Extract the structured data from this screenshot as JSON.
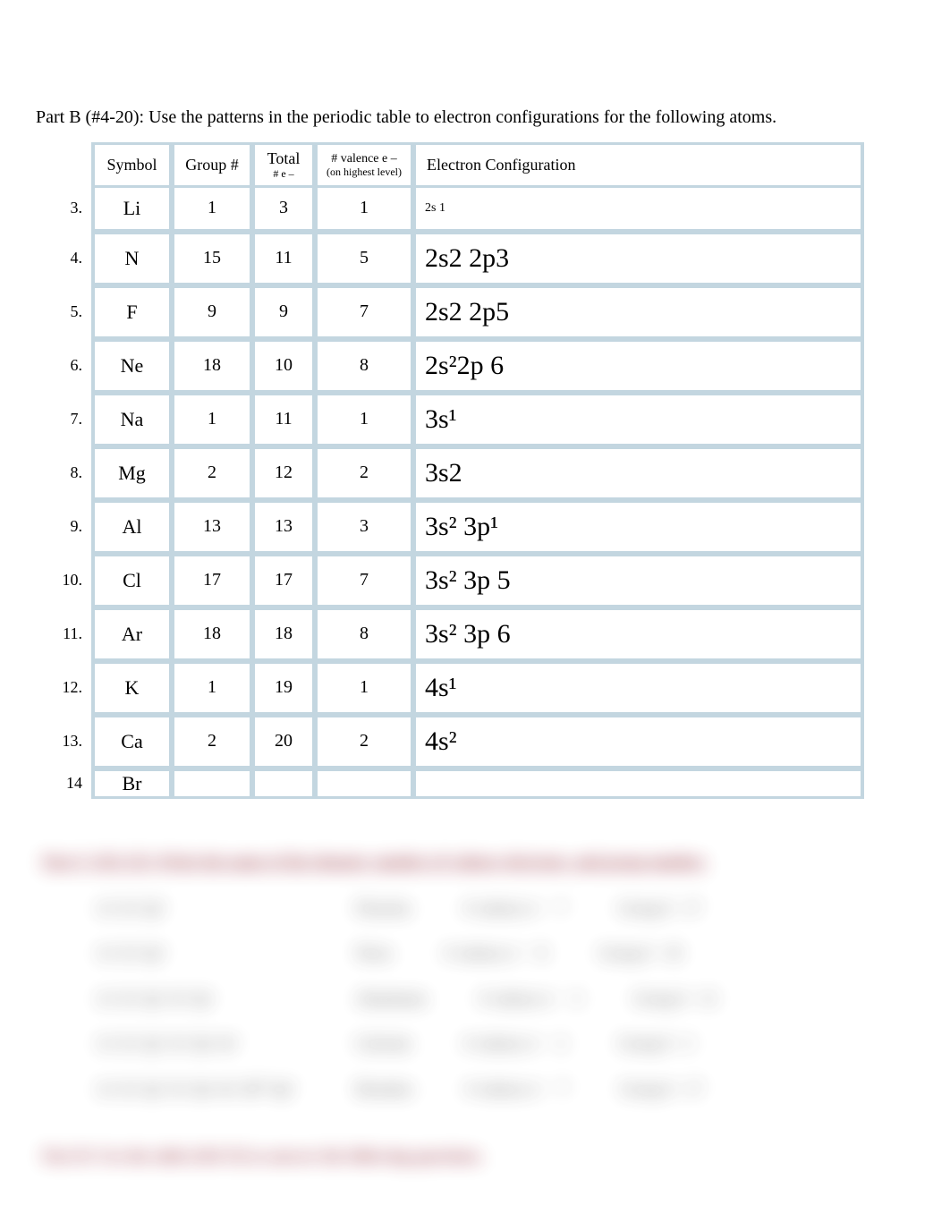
{
  "instruction": "Part B (#4-20): Use the patterns in the periodic table to electron configurations for the following atoms.",
  "headers": {
    "symbol": "Symbol",
    "group": "Group #",
    "total": "Total",
    "total_sub": "# e –",
    "valence": "# valence  e –",
    "valence_sub": "(on highest level)",
    "config": "Electron Configuration"
  },
  "rows": [
    {
      "n": "3.",
      "sym": "Li",
      "grp": "1",
      "tot": "3",
      "val": "1",
      "conf": "2s 1",
      "small": true
    },
    {
      "n": "4.",
      "sym": "N",
      "grp": "15",
      "tot": "11",
      "val": "5",
      "conf": "2s2 2p3"
    },
    {
      "n": "5.",
      "sym": "F",
      "grp": "9",
      "tot": "9",
      "val": "7",
      "conf": "2s2 2p5"
    },
    {
      "n": "6.",
      "sym": "Ne",
      "grp": "18",
      "tot": "10",
      "val": "8",
      "conf": "2s²2p 6"
    },
    {
      "n": "7.",
      "sym": "Na",
      "grp": "1",
      "tot": "11",
      "val": "1",
      "conf": "3s¹"
    },
    {
      "n": "8.",
      "sym": "Mg",
      "grp": "2",
      "tot": "12",
      "val": "2",
      "conf": "3s2"
    },
    {
      "n": "9.",
      "sym": "Al",
      "grp": "13",
      "tot": "13",
      "val": "3",
      "conf": "3s² 3p¹"
    },
    {
      "n": "10.",
      "sym": "Cl",
      "grp": "17",
      "tot": "17",
      "val": "7",
      "conf": "3s² 3p 5"
    },
    {
      "n": "11.",
      "sym": "Ar",
      "grp": "18",
      "tot": "18",
      "val": "8",
      "conf": "3s² 3p 6"
    },
    {
      "n": "12.",
      "sym": "K",
      "grp": "1",
      "tot": "19",
      "val": "1",
      "conf": "4s¹"
    },
    {
      "n": "13.",
      "sym": "Ca",
      "grp": "2",
      "tot": "20",
      "val": "2",
      "conf": "4s²"
    },
    {
      "n": "14",
      "sym": "Br",
      "grp": "",
      "tot": "",
      "val": "",
      "conf": ""
    }
  ],
  "lower": {
    "heading_text": "Part C (#21-25):   Write the name of the element, number of valence electrons, and group number.",
    "items": [
      {
        "c1": "1s² 2s² 2p⁵",
        "name": "Fluorine",
        "val": "7",
        "grp": "17"
      },
      {
        "c1": "1s² 2s² 2p⁶",
        "name": "Neon",
        "val": "8",
        "grp": "18"
      },
      {
        "c1": "1s² 2s² 2p⁶ 3s² 3p¹",
        "name": "Aluminum",
        "val": "3",
        "grp": "13"
      },
      {
        "c1": "1s² 2s² 2p⁶ 3s² 3p⁶ 4s²",
        "name": "Calcium",
        "val": "2",
        "grp": "2"
      },
      {
        "c1": "1s² 2s² 2p⁶ 3s² 3p⁶ 4s² 3d¹⁰ 4p⁵",
        "name": "Bromine",
        "val": "7",
        "grp": "17"
      }
    ],
    "partD": "Part D:   Use the table (#26-35) to answer the following questions."
  }
}
